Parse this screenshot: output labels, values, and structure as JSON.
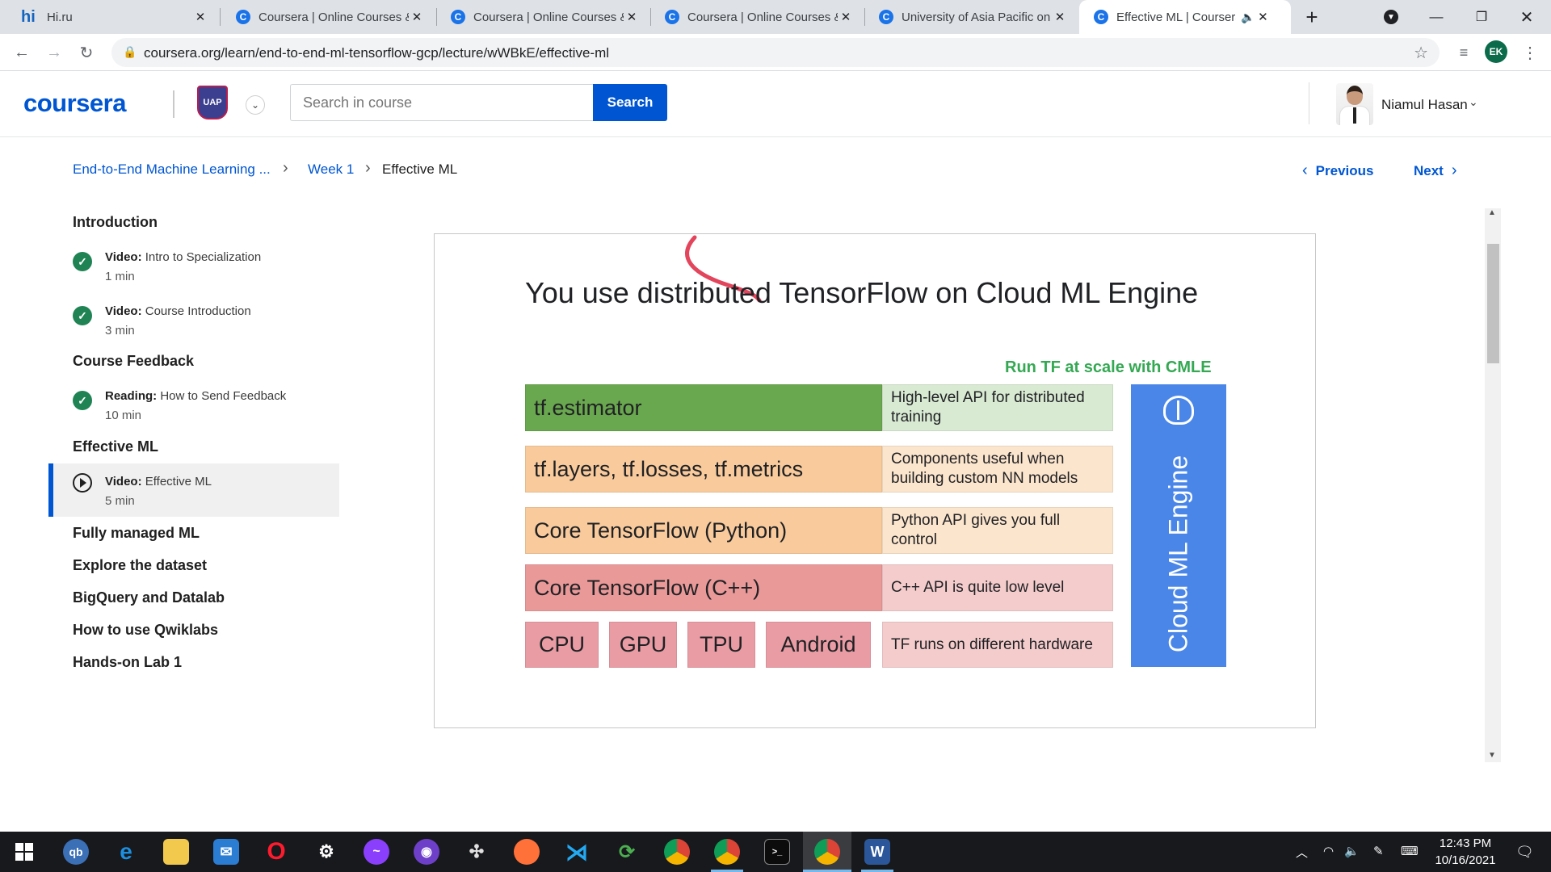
{
  "browser": {
    "tabs": [
      {
        "favicon": "hi-logo",
        "title": "Hi.ru"
      },
      {
        "favicon": "coursera-c",
        "title": "Coursera | Online Courses &"
      },
      {
        "favicon": "coursera-c",
        "title": "Coursera | Online Courses &"
      },
      {
        "favicon": "coursera-c",
        "title": "Coursera | Online Courses &"
      },
      {
        "favicon": "coursera-c",
        "title": "University of Asia Pacific on"
      },
      {
        "favicon": "coursera-c",
        "title": "Effective ML | Coursera",
        "active": true,
        "audio": true
      }
    ],
    "url": "coursera.org/learn/end-to-end-ml-tensorflow-gcp/lecture/wWBkE/effective-ml",
    "profile_initials": "EK"
  },
  "header": {
    "logo": "coursera",
    "search_placeholder": "Search in course",
    "search_button": "Search",
    "user_name": "Niamul Hasan"
  },
  "breadcrumb": {
    "course": "End-to-End Machine Learning ...",
    "week": "Week 1",
    "current": "Effective ML"
  },
  "pager": {
    "previous": "Previous",
    "next": "Next"
  },
  "sidebar": {
    "introduction": {
      "title": "Introduction",
      "items": [
        {
          "type": "Video:",
          "name": "Intro to Specialization",
          "duration": "1 min",
          "status": "completed"
        },
        {
          "type": "Video:",
          "name": "Course Introduction",
          "duration": "3 min",
          "status": "completed"
        }
      ]
    },
    "course_feedback": {
      "title": "Course Feedback",
      "items": [
        {
          "type": "Reading:",
          "name": "How to Send Feedback",
          "duration": "10 min",
          "status": "completed"
        }
      ]
    },
    "effective_ml": {
      "title": "Effective ML",
      "items": [
        {
          "type": "Video:",
          "name": "Effective ML",
          "duration": "5 min",
          "status": "current"
        }
      ]
    },
    "other_sections": [
      "Fully managed ML",
      "Explore the dataset",
      "BigQuery and Datalab",
      "How to use Qwiklabs",
      "Hands-on Lab 1"
    ]
  },
  "slide": {
    "title": "You use distributed TensorFlow on Cloud ML Engine",
    "subtitle": "Run TF at scale with CMLE",
    "rows": [
      {
        "left": "tf.estimator",
        "right": "High-level API for distributed training",
        "left_color": "#6aa84f",
        "right_color": "#d9ead3"
      },
      {
        "left": "tf.layers, tf.losses, tf.metrics",
        "right": "Components useful when building custom NN models",
        "left_color": "#f9cb9c",
        "right_color": "#fce5cd"
      },
      {
        "left": "Core TensorFlow (Python)",
        "right": "Python API gives you full control",
        "left_color": "#f9cb9c",
        "right_color": "#fce5cd"
      },
      {
        "left": "Core TensorFlow (C++)",
        "right": "C++ API is quite low level",
        "left_color": "#ea9999",
        "right_color": "#f4cccc"
      }
    ],
    "hardware": [
      "CPU",
      "GPU",
      "TPU",
      "Android"
    ],
    "hardware_note": "TF runs on different hardware",
    "side_label": "Cloud ML Engine",
    "side_color": "#4a86e8"
  },
  "taskbar": {
    "apps": [
      "windows-start",
      "qbittorrent",
      "edge",
      "file-explorer",
      "mail",
      "opera",
      "satellite-app",
      "messenger",
      "github-desktop",
      "pinwheel-app",
      "firefox",
      "vscode",
      "swirl-app",
      "chrome",
      "chrome-alt",
      "terminal",
      "chrome-profile",
      "word"
    ],
    "time": "12:43 PM",
    "date": "10/16/2021"
  }
}
